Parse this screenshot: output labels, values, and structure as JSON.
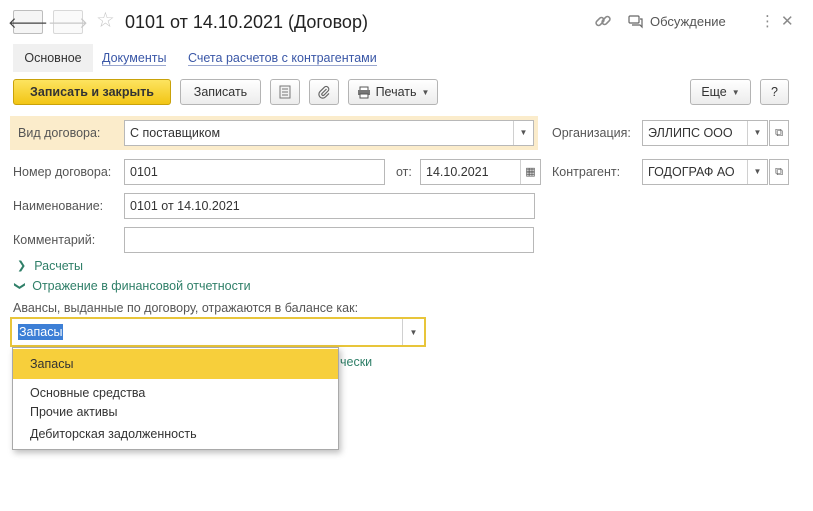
{
  "title": "0101 от 14.10.2021 (Договор)",
  "header": {
    "discuss_label": "Обсуждение"
  },
  "tabs": [
    "Основное",
    "Документы",
    "Счета расчетов с контрагентами"
  ],
  "toolbar": {
    "save_close": "Записать и закрыть",
    "save": "Записать",
    "print": "Печать",
    "more": "Еще",
    "help": "?"
  },
  "form": {
    "contract_type_label": "Вид договора:",
    "contract_type_value": "С поставщиком",
    "org_label": "Организация:",
    "org_value": "ЭЛЛИПС ООО",
    "number_label": "Номер договора:",
    "number_value": "0101",
    "date_label": "от:",
    "date_value": "14.10.2021",
    "counterparty_label": "Контрагент:",
    "counterparty_value": "ГОДОГРАФ АО",
    "name_label": "Наименование:",
    "name_value": "0101 от 14.10.2021",
    "comment_label": "Комментарий:",
    "comment_value": "",
    "group_settlements": "Расчеты",
    "group_reporting": "Отражение в финансовой отчетности",
    "advances_label": "Авансы, выданные по договору, отражаются в балансе как:",
    "advances_value": "Запасы",
    "partial_link_text": "чески"
  },
  "dropdown": {
    "options": [
      "Запасы",
      "Основные средства",
      "Прочие активы",
      "Дебиторская задолженность"
    ],
    "selected": "Запасы"
  },
  "colors": {
    "accent_yellow": "#f7cf3b",
    "link_blue": "#3a57a7",
    "group_green": "#2f7f68",
    "highlight_row": "#fbeccb"
  }
}
